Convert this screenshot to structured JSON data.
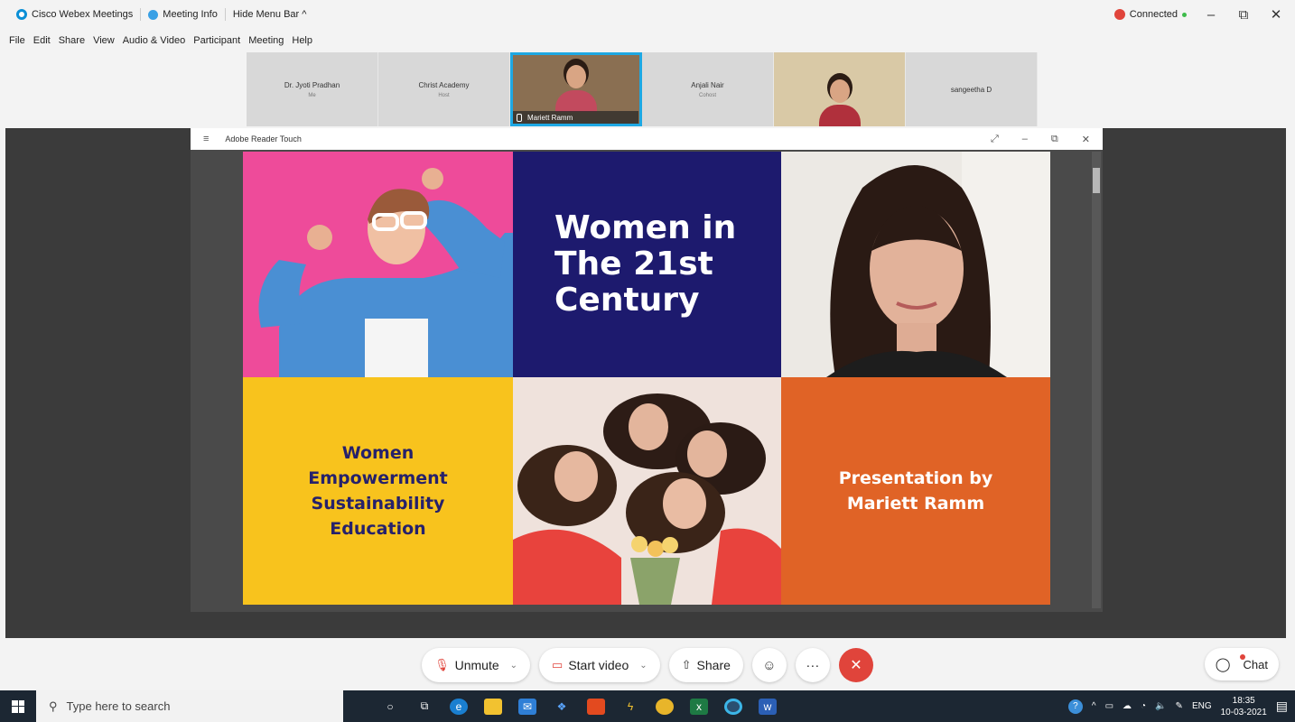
{
  "titlebar": {
    "app_title": "Cisco Webex Meetings",
    "meeting_info": "Meeting Info",
    "hide_menu": "Hide Menu Bar ^",
    "status": "Connected",
    "min": "–",
    "restore": "⧉",
    "close": "✕"
  },
  "menu": [
    "File",
    "Edit",
    "Share",
    "View",
    "Audio & Video",
    "Participant",
    "Meeting",
    "Help"
  ],
  "participants": [
    {
      "name": "Dr. Jyoti Pradhan",
      "role": "Me"
    },
    {
      "name": "Christ Academy",
      "role": "Host"
    },
    {
      "name": "Mariett Ramm",
      "role": ""
    },
    {
      "name": "Anjali Nair",
      "role": "Cohost"
    },
    {
      "name": "",
      "role": ""
    },
    {
      "name": "sangeetha D",
      "role": ""
    }
  ],
  "reader": {
    "title": "Adobe Reader Touch",
    "menu_icon": "≡",
    "expand_icon": "⤢",
    "min_icon": "–",
    "restore_icon": "⧉",
    "close_icon": "✕"
  },
  "slide": {
    "title_line1": "Women in",
    "title_line2": "The 21st",
    "title_line3": "Century",
    "sub_line1": "Women",
    "sub_line2": "Empowerment",
    "sub_line3": "Sustainability",
    "sub_line4": "Education",
    "by_line1": "Presentation by",
    "by_line2": "Mariett Ramm"
  },
  "controls": {
    "unmute": "Unmute",
    "start_video": "Start video",
    "share": "Share",
    "emoji_icon": "☺",
    "more_icon": "···",
    "end_icon": "✕",
    "chat": "Chat"
  },
  "taskbar": {
    "search_placeholder": "Type here to search",
    "lang": "ENG",
    "time": "18:35",
    "date": "10-03-2021"
  },
  "colors": {
    "pink": "#ee4b9a",
    "navy": "#1d1a6e",
    "yellow": "#f8c31d",
    "orange": "#e06326",
    "accent": "#1ea8e3",
    "end_red": "#e0443b"
  }
}
